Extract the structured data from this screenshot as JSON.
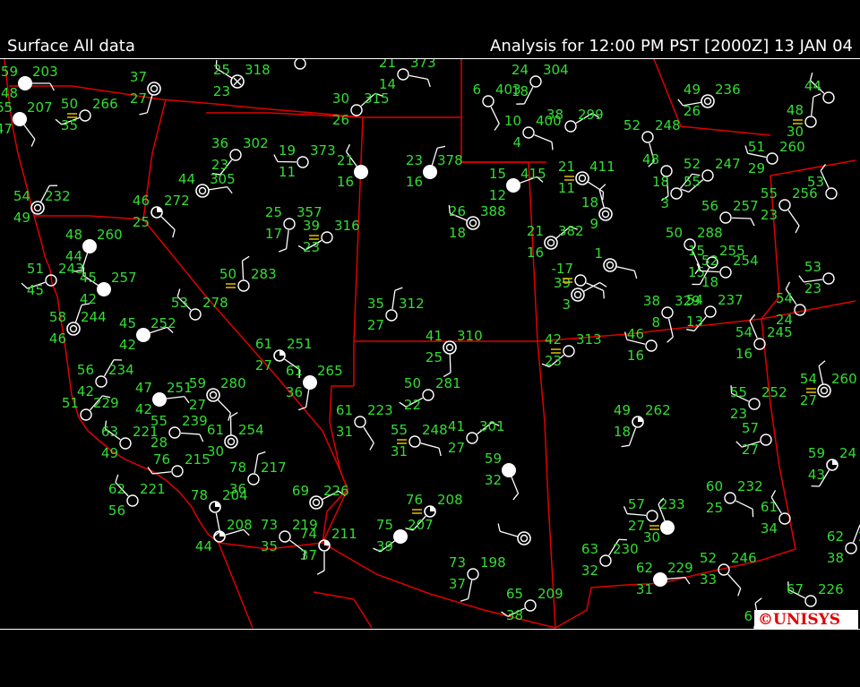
{
  "header": {
    "left": "Surface All data",
    "right": "Analysis for 12:00 PM PST [2000Z] 13 JAN 04"
  },
  "logo": {
    "text": "©UNISYS"
  },
  "colors": {
    "background": "#000000",
    "station_text": "#33dd33",
    "borders": "#e00000",
    "symbols": "#ffffff",
    "fog": "#e0c000",
    "logo": "#e00000"
  },
  "stations": [
    {
      "t": "59",
      "d": "203",
      "tl": "48",
      "dl": "",
      "cover": "overcast"
    },
    {
      "t": "65",
      "d": "207",
      "tl": "47",
      "dl": "",
      "cover": "overcast"
    },
    {
      "t": "37",
      "d": "",
      "tl": "27",
      "dl": "",
      "cover": "scattered"
    },
    {
      "t": "50",
      "d": "266",
      "tl": "35",
      "dl": "",
      "cover": "clear"
    },
    {
      "t": "25",
      "d": "318",
      "tl": "23",
      "dl": "",
      "cover": "obscured"
    },
    {
      "t": "19",
      "d": "",
      "tl": "",
      "dl": "",
      "cover": "clear"
    },
    {
      "t": "30",
      "d": "315",
      "tl": "26",
      "dl": "",
      "cover": "clear"
    },
    {
      "t": "21",
      "d": "373",
      "tl": "14",
      "dl": "",
      "cover": "clear"
    },
    {
      "t": "6",
      "d": "403",
      "tl": "",
      "dl": "",
      "cover": "clear"
    },
    {
      "t": "24",
      "d": "304",
      "tl": "18",
      "dl": "",
      "cover": "clear"
    },
    {
      "t": "49",
      "d": "236",
      "tl": "26",
      "dl": "",
      "cover": "scattered"
    },
    {
      "t": "44",
      "d": "",
      "tl": "",
      "dl": "",
      "cover": "clear"
    },
    {
      "t": "48",
      "d": "",
      "tl": "30",
      "dl": "",
      "cover": "clear"
    },
    {
      "t": "38",
      "d": "299",
      "tl": "",
      "dl": "",
      "cover": "clear"
    },
    {
      "t": "10",
      "d": "400",
      "tl": "4",
      "dl": "",
      "cover": "clear"
    },
    {
      "t": "52",
      "d": "248",
      "tl": "",
      "dl": "",
      "cover": "clear"
    },
    {
      "t": "36",
      "d": "302",
      "tl": "23",
      "dl": "",
      "cover": "clear"
    },
    {
      "t": "19",
      "d": "373",
      "tl": "11",
      "dl": "",
      "cover": "clear"
    },
    {
      "t": "21",
      "d": "",
      "tl": "16",
      "dl": "",
      "cover": "overcast"
    },
    {
      "t": "23",
      "d": "378",
      "tl": "16",
      "dl": "",
      "cover": "overcast"
    },
    {
      "t": "15",
      "d": "415",
      "tl": "12",
      "dl": "",
      "cover": "overcast"
    },
    {
      "t": "21",
      "d": "411",
      "tl": "11",
      "dl": "",
      "cover": "scattered"
    },
    {
      "t": "48",
      "d": "",
      "tl": "",
      "dl": "",
      "cover": "clear"
    },
    {
      "t": "52",
      "d": "247",
      "tl": "",
      "dl": "",
      "cover": "clear"
    },
    {
      "t": "51",
      "d": "260",
      "tl": "29",
      "dl": "",
      "cover": "clear"
    },
    {
      "t": "53",
      "d": "",
      "tl": "",
      "dl": "",
      "cover": "clear"
    },
    {
      "t": "54",
      "d": "232",
      "tl": "49",
      "dl": "",
      "cover": "scattered"
    },
    {
      "t": "44",
      "d": "305",
      "tl": "",
      "dl": "",
      "cover": "scattered"
    },
    {
      "t": "46",
      "d": "272",
      "tl": "25",
      "dl": "",
      "cover": "broken"
    },
    {
      "t": "25",
      "d": "357",
      "tl": "17",
      "dl": "",
      "cover": "clear"
    },
    {
      "t": "39",
      "d": "316",
      "tl": "23",
      "dl": "",
      "cover": "clear"
    },
    {
      "t": "26",
      "d": "388",
      "tl": "18",
      "dl": "",
      "cover": "scattered"
    },
    {
      "t": "18",
      "d": "",
      "tl": "9",
      "dl": "",
      "cover": "scattered"
    },
    {
      "t": "18",
      "d": "55",
      "tl": "3",
      "dl": "",
      "cover": "clear"
    },
    {
      "t": "56",
      "d": "257",
      "tl": "",
      "dl": "",
      "cover": "clear"
    },
    {
      "t": "55",
      "d": "256",
      "tl": "23",
      "dl": "",
      "cover": "clear"
    },
    {
      "t": "48",
      "d": "260",
      "tl": "44",
      "dl": "",
      "cover": "overcast"
    },
    {
      "t": "51",
      "d": "243",
      "tl": "45",
      "dl": "",
      "cover": "clear"
    },
    {
      "t": "45",
      "d": "257",
      "tl": "42",
      "dl": "",
      "cover": "overcast"
    },
    {
      "t": "50",
      "d": "283",
      "tl": "",
      "dl": "",
      "cover": "clear"
    },
    {
      "t": "21",
      "d": "382",
      "tl": "16",
      "dl": "",
      "cover": "scattered"
    },
    {
      "t": "1",
      "d": "",
      "tl": "",
      "dl": "",
      "cover": "scattered"
    },
    {
      "t": "50",
      "d": "288",
      "tl": "",
      "dl": "",
      "cover": "clear"
    },
    {
      "t": "15",
      "d": "255",
      "tl": "15",
      "dl": "",
      "cover": "clear"
    },
    {
      "t": "53",
      "d": "",
      "tl": "23",
      "dl": "",
      "cover": "clear"
    },
    {
      "t": "53",
      "d": "278",
      "tl": "",
      "dl": "",
      "cover": "clear"
    },
    {
      "t": "35",
      "d": "312",
      "tl": "27",
      "dl": "",
      "cover": "clear"
    },
    {
      "t": "39",
      "d": "",
      "tl": "3",
      "dl": "",
      "cover": "scattered"
    },
    {
      "t": "-17",
      "d": "",
      "tl": "",
      "dl": "",
      "cover": "clear"
    },
    {
      "t": "38",
      "d": "329",
      "tl": "8",
      "dl": "",
      "cover": "clear"
    },
    {
      "t": "54",
      "d": "237",
      "tl": "13",
      "dl": "",
      "cover": "clear"
    },
    {
      "t": "52",
      "d": "254",
      "tl": "18",
      "dl": "",
      "cover": "clear"
    },
    {
      "t": "54",
      "d": "",
      "tl": "24",
      "dl": "",
      "cover": "clear"
    },
    {
      "t": "58",
      "d": "244",
      "tl": "46",
      "dl": "",
      "cover": "scattered"
    },
    {
      "t": "45",
      "d": "252",
      "tl": "42",
      "dl": "",
      "cover": "overcast"
    },
    {
      "t": "61",
      "d": "251",
      "tl": "27",
      "dl": "",
      "cover": "broken"
    },
    {
      "t": "41",
      "d": "310",
      "tl": "25",
      "dl": "",
      "cover": "scattered"
    },
    {
      "t": "42",
      "d": "313",
      "tl": "23",
      "dl": "",
      "cover": "clear"
    },
    {
      "t": "46",
      "d": "",
      "tl": "16",
      "dl": "",
      "cover": "clear"
    },
    {
      "t": "54",
      "d": "245",
      "tl": "16",
      "dl": "",
      "cover": "clear"
    },
    {
      "t": "56",
      "d": "234",
      "tl": "42",
      "dl": "",
      "cover": "clear"
    },
    {
      "t": "47",
      "d": "251",
      "tl": "42",
      "dl": "",
      "cover": "overcast"
    },
    {
      "t": "59",
      "d": "280",
      "tl": "27",
      "dl": "",
      "cover": "scattered"
    },
    {
      "t": "61",
      "d": "265",
      "tl": "36",
      "dl": "",
      "cover": "overcast"
    },
    {
      "t": "50",
      "d": "281",
      "tl": "22",
      "dl": "",
      "cover": "clear"
    },
    {
      "t": "55",
      "d": "252",
      "tl": "23",
      "dl": "",
      "cover": "clear"
    },
    {
      "t": "54",
      "d": "260",
      "tl": "27",
      "dl": "",
      "cover": "scattered"
    },
    {
      "t": "51",
      "d": "229",
      "tl": "",
      "dl": "",
      "cover": "clear"
    },
    {
      "t": "55",
      "d": "239",
      "tl": "28",
      "dl": "",
      "cover": "clear"
    },
    {
      "t": "61",
      "d": "223",
      "tl": "31",
      "dl": "",
      "cover": "clear"
    },
    {
      "t": "49",
      "d": "262",
      "tl": "18",
      "dl": "",
      "cover": "broken"
    },
    {
      "t": "57",
      "d": "",
      "tl": "27",
      "dl": "",
      "cover": "clear"
    },
    {
      "t": "63",
      "d": "221",
      "tl": "49",
      "dl": "",
      "cover": "clear"
    },
    {
      "t": "61",
      "d": "254",
      "tl": "30",
      "dl": "",
      "cover": "scattered"
    },
    {
      "t": "41",
      "d": "301",
      "tl": "27",
      "dl": "",
      "cover": "clear"
    },
    {
      "t": "55",
      "d": "248",
      "tl": "31",
      "dl": "",
      "cover": "clear"
    },
    {
      "t": "59",
      "d": "",
      "tl": "32",
      "dl": "",
      "cover": "overcast"
    },
    {
      "t": "59",
      "d": "24",
      "tl": "43",
      "dl": "",
      "cover": "broken"
    },
    {
      "t": "76",
      "d": "215",
      "tl": "",
      "dl": "",
      "cover": "clear"
    },
    {
      "t": "62",
      "d": "221",
      "tl": "56",
      "dl": "",
      "cover": "clear"
    },
    {
      "t": "78",
      "d": "217",
      "tl": "36",
      "dl": "",
      "cover": "clear"
    },
    {
      "t": "69",
      "d": "226",
      "tl": "",
      "dl": "",
      "cover": "scattered"
    },
    {
      "t": "60",
      "d": "232",
      "tl": "25",
      "dl": "",
      "cover": "clear"
    },
    {
      "t": "78",
      "d": "204",
      "tl": "",
      "dl": "",
      "cover": "broken"
    },
    {
      "t": "76",
      "d": "208",
      "tl": "",
      "dl": "",
      "cover": "broken"
    },
    {
      "t": "57",
      "d": "233",
      "tl": "27",
      "dl": "",
      "cover": "clear"
    },
    {
      "t": "61",
      "d": "",
      "tl": "34",
      "dl": "",
      "cover": "clear"
    },
    {
      "t": "62",
      "d": "2",
      "tl": "38",
      "dl": "",
      "cover": "clear"
    },
    {
      "t": "",
      "d": "208",
      "tl": "44",
      "dl": "",
      "cover": "broken"
    },
    {
      "t": "73",
      "d": "219",
      "tl": "35",
      "dl": "",
      "cover": "clear"
    },
    {
      "t": "74",
      "d": "211",
      "tl": "37",
      "dl": "",
      "cover": "broken"
    },
    {
      "t": "75",
      "d": "207",
      "tl": "39",
      "dl": "",
      "cover": "overcast"
    },
    {
      "t": "",
      "d": "",
      "tl": "",
      "dl": "",
      "cover": "scattered"
    },
    {
      "t": "",
      "d": "",
      "tl": "30",
      "dl": "",
      "cover": "overcast"
    },
    {
      "t": "63",
      "d": "230",
      "tl": "32",
      "dl": "",
      "cover": "clear"
    },
    {
      "t": "62",
      "d": "229",
      "tl": "31",
      "dl": "",
      "cover": "overcast"
    },
    {
      "t": "52",
      "d": "246",
      "tl": "33",
      "dl": "",
      "cover": "clear"
    },
    {
      "t": "73",
      "d": "198",
      "tl": "37",
      "dl": "",
      "cover": "clear"
    },
    {
      "t": "65",
      "d": "209",
      "tl": "38",
      "dl": "",
      "cover": "clear"
    },
    {
      "t": "67",
      "d": "226",
      "tl": "",
      "dl": "",
      "cover": "clear"
    },
    {
      "t": "6",
      "d": "",
      "tl": "",
      "dl": "",
      "cover": "clear"
    }
  ]
}
